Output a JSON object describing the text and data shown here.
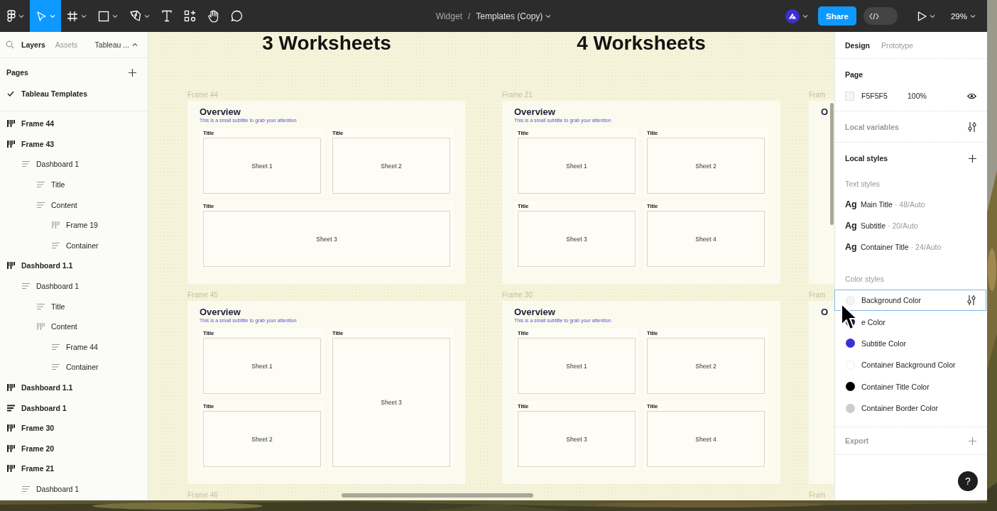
{
  "toolbar": {
    "tools": [
      {
        "kind": "main-menu",
        "selected": false,
        "caret": true
      },
      {
        "kind": "move",
        "selected": true,
        "caret": true
      },
      {
        "kind": "frame",
        "selected": false,
        "caret": true
      },
      {
        "kind": "shape",
        "selected": false,
        "caret": true
      },
      {
        "kind": "pen",
        "selected": false,
        "caret": true
      },
      {
        "kind": "text",
        "selected": false,
        "caret": false
      },
      {
        "kind": "resources",
        "selected": false,
        "caret": false
      },
      {
        "kind": "hand",
        "selected": false,
        "caret": false
      },
      {
        "kind": "comment",
        "selected": false,
        "caret": false
      }
    ],
    "breadcrumb": {
      "project": "Widget",
      "separator": "/",
      "file": "Templates (Copy)"
    },
    "share_button": "Share",
    "dev_mode": false,
    "zoom": "29%"
  },
  "layers_panel": {
    "tabs": [
      {
        "label": "Layers",
        "selected": true
      },
      {
        "label": "Assets",
        "selected": false
      }
    ],
    "page_menu": "Tableau ...",
    "pages_heading": "Pages",
    "pages": [
      {
        "label": "Tableau Templates",
        "selected": true
      }
    ],
    "layers": [
      {
        "label": "Frame 44",
        "kind": "columns"
      },
      {
        "label": "Frame 43",
        "kind": "columns",
        "children": [
          {
            "label": "Dashboard 1",
            "kind": "rows",
            "children": [
              {
                "label": "Title",
                "kind": "rows"
              },
              {
                "label": "Content",
                "kind": "rows",
                "children": [
                  {
                    "label": "Frame 19",
                    "kind": "columns"
                  },
                  {
                    "label": "Container",
                    "kind": "rows"
                  }
                ]
              }
            ]
          }
        ]
      },
      {
        "label": "Dashboard 1.1",
        "kind": "columns",
        "children": [
          {
            "label": "Dashboard 1",
            "kind": "rows",
            "children": [
              {
                "label": "Title",
                "kind": "rows"
              },
              {
                "label": "Content",
                "kind": "columns",
                "children": [
                  {
                    "label": "Frame 44",
                    "kind": "rows"
                  },
                  {
                    "label": "Container",
                    "kind": "rows"
                  }
                ]
              }
            ]
          }
        ]
      },
      {
        "label": "Dashboard 1.1",
        "kind": "columns"
      },
      {
        "label": "Dashboard 1",
        "kind": "rows"
      },
      {
        "label": "Frame 30",
        "kind": "columns"
      },
      {
        "label": "Frame 20",
        "kind": "columns"
      },
      {
        "label": "Frame 21",
        "kind": "columns",
        "children": [
          {
            "label": "Dashboard 1",
            "kind": "rows"
          }
        ]
      }
    ]
  },
  "canvas": {
    "columns": [
      {
        "heading": "3 Worksheets",
        "frames": [
          {
            "label": "Frame 44",
            "title": "Overview",
            "subtitle": "This is a small subtitle to grab your attention",
            "kind": "three-wide",
            "containers": [
              {
                "title": "Title",
                "sheet": "Sheet 1"
              },
              {
                "title": "Title",
                "sheet": "Sheet 2"
              },
              {
                "title": "Title",
                "sheet": "Sheet 3"
              }
            ]
          },
          {
            "label": "Frame 45",
            "title": "Overview",
            "subtitle": "This is a small subtitle to grab your attention",
            "kind": "three-tall",
            "containers": [
              {
                "title": "Title",
                "sheet": "Sheet 1"
              },
              {
                "title": "Title",
                "sheet": "Sheet 3"
              },
              {
                "title": "Title",
                "sheet": "Sheet 2"
              }
            ]
          },
          {
            "label": "Frame 46"
          }
        ]
      },
      {
        "heading": "4 Worksheets",
        "frames": [
          {
            "label": "Frame 21",
            "title": "Overview",
            "subtitle": "This is a small subtitle to grab your attention",
            "kind": "four-grid",
            "containers": [
              {
                "title": "Title",
                "sheet": "Sheet 1"
              },
              {
                "title": "Title",
                "sheet": "Sheet 2"
              },
              {
                "title": "Title",
                "sheet": "Sheet 3"
              },
              {
                "title": "Title",
                "sheet": "Sheet 4"
              }
            ]
          },
          {
            "label": "Frame 30",
            "title": "Overview",
            "subtitle": "This is a small subtitle to grab your attention",
            "kind": "four-grid",
            "containers": [
              {
                "title": "Title",
                "sheet": "Sheet 1"
              },
              {
                "title": "Title",
                "sheet": "Sheet 2"
              },
              {
                "title": "Title",
                "sheet": "Sheet 3"
              },
              {
                "title": "Title",
                "sheet": "Sheet 4"
              }
            ]
          }
        ]
      },
      {
        "frames": [
          {
            "label": "Fram",
            "title": "O"
          },
          {
            "label": "Fram",
            "title": "O"
          },
          {
            "label": "Fram"
          }
        ]
      }
    ]
  },
  "design_panel": {
    "tabs": [
      {
        "label": "Design",
        "selected": true
      },
      {
        "label": "Prototype",
        "selected": false
      }
    ],
    "page_heading": "Page",
    "page_color": "F5F5F5",
    "page_opacity": "100%",
    "local_variables": "Local variables",
    "local_styles": "Local styles",
    "text_styles_heading": "Text styles",
    "text_styles": [
      {
        "sample": "Ag",
        "name": "Main Title",
        "spec": "· 48/Auto"
      },
      {
        "sample": "Ag",
        "name": "Subtitle",
        "spec": "· 20/Auto"
      },
      {
        "sample": "Ag",
        "name": "Container Title",
        "spec": "· 24/Auto"
      }
    ],
    "color_styles_heading": "Color styles",
    "color_styles": [
      {
        "name": "Background Color",
        "color": "#f5f5f5",
        "selected": true
      },
      {
        "name": "e Color",
        "color": "#1c1c48",
        "selected": false
      },
      {
        "name": "Subtitle Color",
        "color": "#3b30d6",
        "selected": false
      },
      {
        "name": "Container Background Color",
        "color": "#ffffff",
        "selected": false
      },
      {
        "name": "Container Title Color",
        "color": "#000000",
        "selected": false
      },
      {
        "name": "Container Border Color",
        "color": "#cccccc",
        "selected": false
      }
    ],
    "export": "Export",
    "help": "?"
  }
}
